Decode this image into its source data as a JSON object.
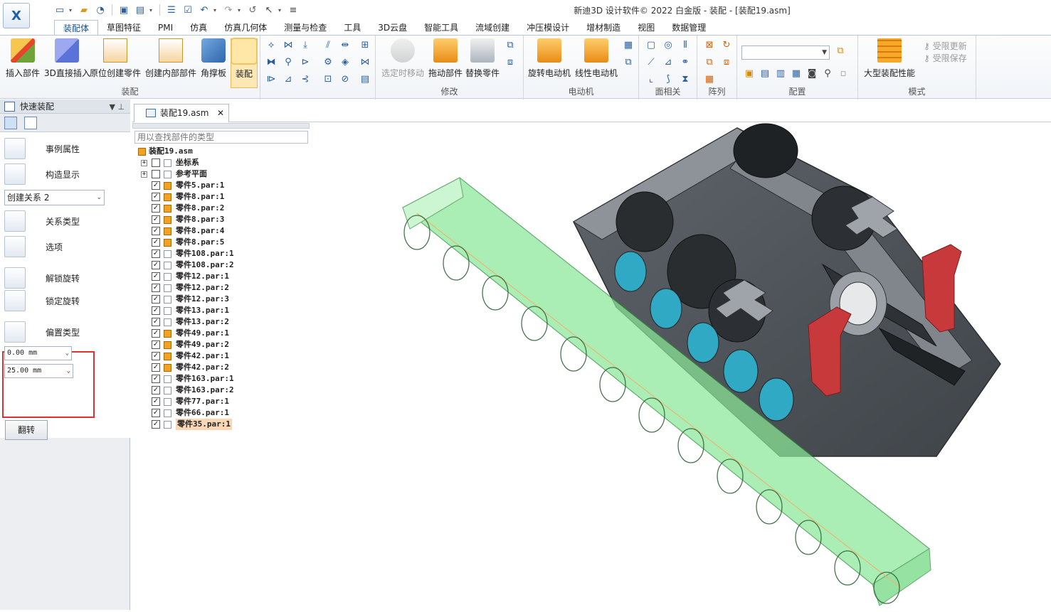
{
  "window": {
    "title": "新迪3D 设计软件© 2022 白金版 - 装配 - [装配19.asm]"
  },
  "quick_access": [
    "new-icon",
    "open-icon",
    "save-icon",
    "undo-icon",
    "redo-icon",
    "select-icon"
  ],
  "ribbon": {
    "tabs": [
      "装配体",
      "草图特征",
      "PMI",
      "仿真",
      "仿真几何体",
      "测量与检查",
      "工具",
      "3D云盘",
      "智能工具",
      "流域创建",
      "冲压模设计",
      "增材制造",
      "视图",
      "数据管理"
    ],
    "active_tab": "装配体",
    "groups": {
      "assembly": {
        "label": "装配",
        "buttons": [
          "插入部件",
          "3D直接插入",
          "原位创建零件",
          "创建内部部件",
          "角撑板",
          "装配"
        ]
      },
      "modify": {
        "label": "修改",
        "buttons": [
          "选定时移动",
          "拖动部件",
          "替换零件"
        ]
      },
      "motor": {
        "label": "电动机",
        "buttons": [
          "旋转电动机",
          "线性电动机"
        ]
      },
      "face": {
        "label": "面相关"
      },
      "pattern": {
        "label": "阵列"
      },
      "config": {
        "label": "配置"
      },
      "mode": {
        "label": "模式",
        "buttons": [
          "大型装配性能"
        ],
        "limit_update": "受限更新",
        "limit_save": "受限保存"
      }
    }
  },
  "left_panel": {
    "title": "快速装配",
    "items": {
      "instance_props": "事例属性",
      "construct_display": "构造显示",
      "create_relation": "创建关系  2",
      "relation_type": "关系类型",
      "options": "选项",
      "unlock_rotation": "解锁旋转",
      "lock_rotation": "锁定旋转",
      "offset_type": "偏置类型",
      "offset_value_1": "0.00 mm",
      "offset_value_2": "25.00 mm",
      "flip": "翻转"
    }
  },
  "document": {
    "tab_label": "装配19.asm",
    "search_placeholder": "用以查找部件的类型",
    "tree": {
      "root": "装配19.asm",
      "folders": [
        "坐标系",
        "参考平面"
      ],
      "parts": [
        {
          "name": "零件5.par:1",
          "active": true
        },
        {
          "name": "零件8.par:1",
          "active": true
        },
        {
          "name": "零件8.par:2",
          "active": true
        },
        {
          "name": "零件8.par:3",
          "active": true
        },
        {
          "name": "零件8.par:4",
          "active": true
        },
        {
          "name": "零件8.par:5",
          "active": true
        },
        {
          "name": "零件108.par:1",
          "active": false
        },
        {
          "name": "零件108.par:2",
          "active": false
        },
        {
          "name": "零件12.par:1",
          "active": false
        },
        {
          "name": "零件12.par:2",
          "active": false
        },
        {
          "name": "零件12.par:3",
          "active": false
        },
        {
          "name": "零件13.par:1",
          "active": false
        },
        {
          "name": "零件13.par:2",
          "active": false
        },
        {
          "name": "零件49.par:1",
          "active": true
        },
        {
          "name": "零件49.par:2",
          "active": true
        },
        {
          "name": "零件42.par:1",
          "active": true
        },
        {
          "name": "零件42.par:2",
          "active": true
        },
        {
          "name": "零件163.par:1",
          "active": false
        },
        {
          "name": "零件163.par:2",
          "active": false
        },
        {
          "name": "零件77.par:1",
          "active": false
        },
        {
          "name": "零件66.par:1",
          "active": false
        },
        {
          "name": "零件35.par:1",
          "active": false,
          "selected": true
        }
      ]
    }
  },
  "colors": {
    "accent": "#1b4f96",
    "highlight_box": "#e03030",
    "selection": "#f9d7b5",
    "transparent_part": "#7ee08a"
  }
}
